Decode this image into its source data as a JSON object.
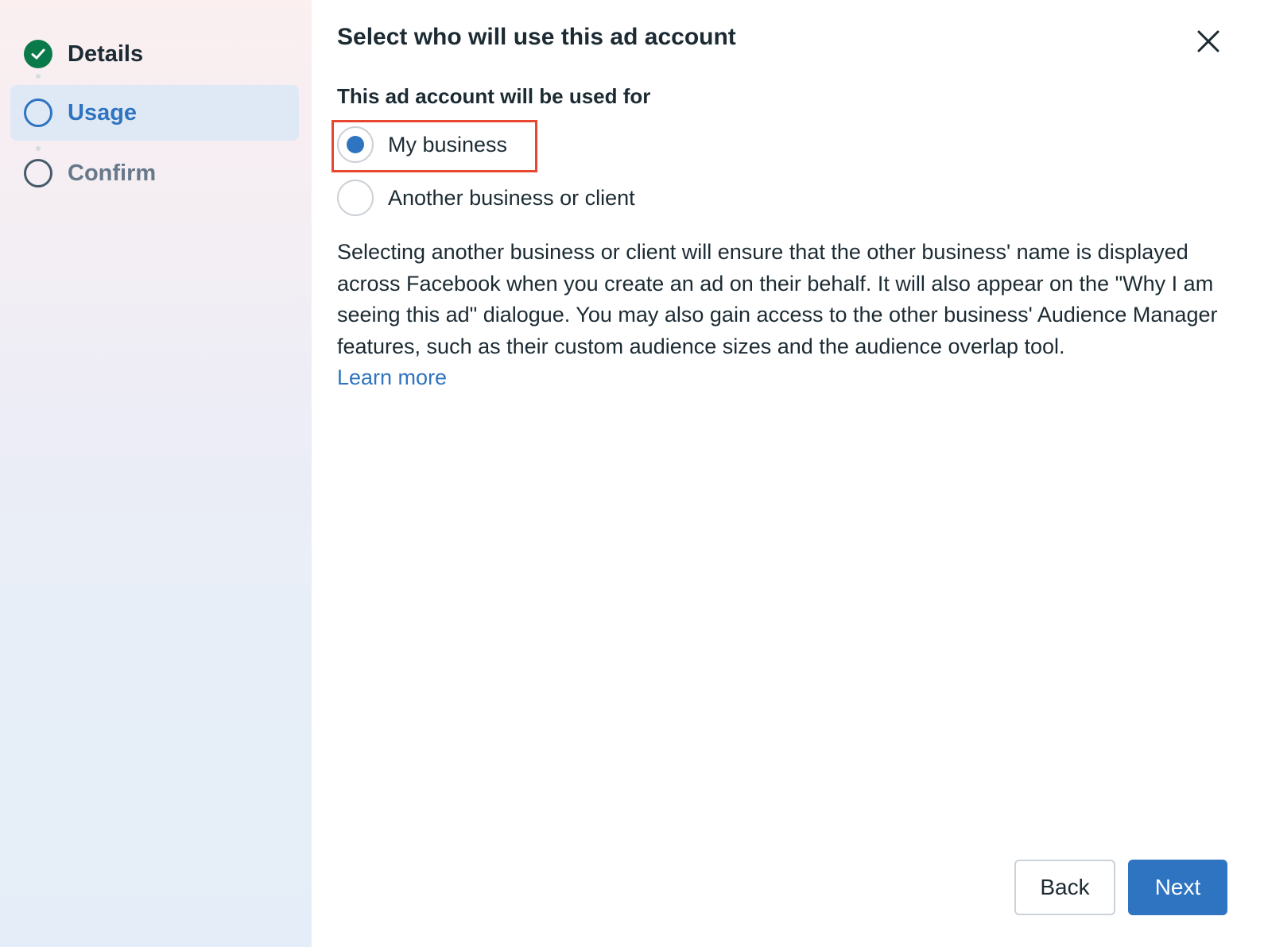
{
  "steps": [
    {
      "label": "Details",
      "state": "done"
    },
    {
      "label": "Usage",
      "state": "current"
    },
    {
      "label": "Confirm",
      "state": "pending"
    }
  ],
  "dialog": {
    "title": "Select who will use this ad account",
    "section_label": "This ad account will be used for",
    "options": [
      {
        "label": "My business",
        "selected": true
      },
      {
        "label": "Another business or client",
        "selected": false
      }
    ],
    "description": "Selecting another business or client will ensure that the other business' name is displayed across Facebook when you create an ad on their behalf. It will also appear on the \"Why I am seeing this ad\" dialogue. You may also gain access to the other business' Audience Manager features, such as their custom audience sizes and the audience overlap tool.",
    "learn_more": "Learn more",
    "back_label": "Back",
    "next_label": "Next"
  },
  "colors": {
    "accent": "#2f74c0",
    "done": "#0b7a4b",
    "highlight": "#e8472f"
  }
}
